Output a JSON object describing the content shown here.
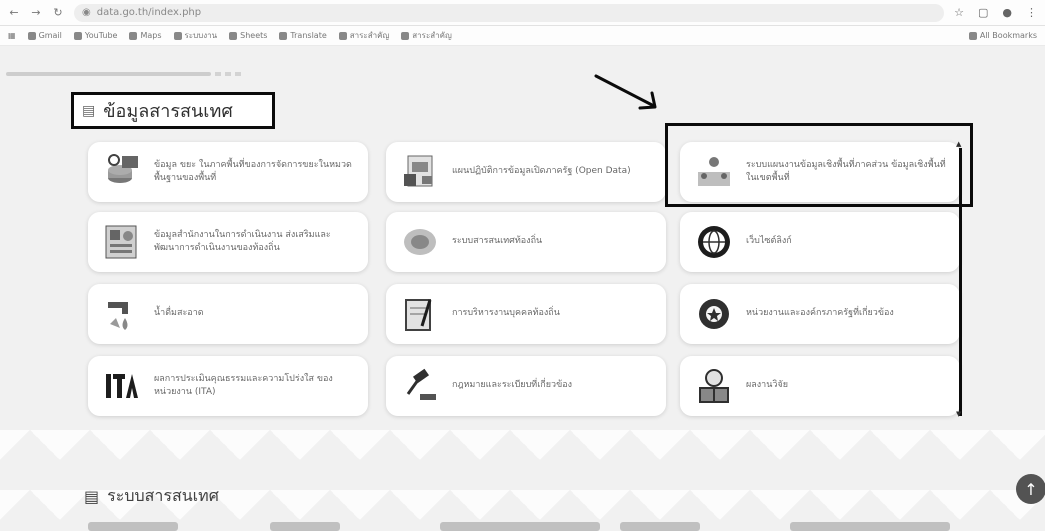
{
  "browser": {
    "address": "data.go.th/index.php",
    "back": "←",
    "forward": "→",
    "reload": "↻",
    "bookmarks": [
      "Gmail",
      "YouTube",
      "Maps",
      "ระบบงาน",
      "Sheets",
      "Translate",
      "สาระสำคัญ",
      "สาระสำคัญ"
    ],
    "bookmarks_right": "All Bookmarks"
  },
  "section_title": "ข้อมูลสารสนเทศ",
  "cards": [
    {
      "label": "ข้อมูล ขยะ ในภาคพื้นที่ของการจัดการขยะในหมวดพื้นฐานของพื้นที่"
    },
    {
      "label": "แผนปฏิบัติการข้อมูลเปิดภาครัฐ (Open Data)"
    },
    {
      "label": "ระบบแผนงานข้อมูลเชิงพื้นที่ภาคส่วน ข้อมูลเชิงพื้นที่ในเขตพื้นที่"
    },
    {
      "label": "ข้อมูลสำนักงานในการดำเนินงาน ส่งเสริมและพัฒนาการดำเนินงานของท้องถิ่น"
    },
    {
      "label": "ระบบสารสนเทศท้องถิ่น"
    },
    {
      "label": "เว็บไซต์ลิงก์"
    },
    {
      "label": "น้ำดื่มสะอาด"
    },
    {
      "label": "การบริหารงานบุคคลท้องถิ่น"
    },
    {
      "label": "หน่วยงานและองค์กรภาครัฐที่เกี่ยวข้อง"
    },
    {
      "label": "ผลการประเมินคุณธรรมและความโปร่งใส ของหน่วยงาน (ITA)"
    },
    {
      "label": "กฎหมายและระเบียบที่เกี่ยวข้อง"
    },
    {
      "label": "ผลงานวิจัย"
    }
  ],
  "lower_title": "ระบบสารสนเทศ",
  "up_button": "↑"
}
